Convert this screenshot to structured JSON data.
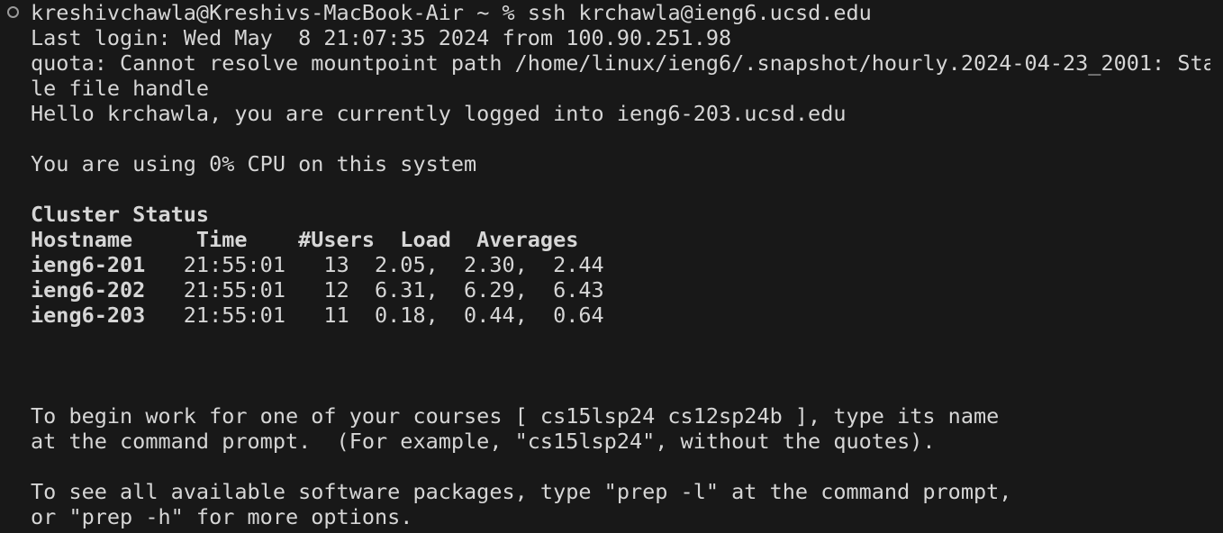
{
  "prompt": {
    "user_host": "kreshivchawla@Kreshivs-MacBook-Air",
    "path": "~",
    "symbol": "%",
    "command": "ssh krchawla@ieng6.ucsd.edu"
  },
  "login": {
    "last_login": "Last login: Wed May  8 21:07:35 2024 from 100.90.251.98",
    "quota_line1": "quota: Cannot resolve mountpoint path /home/linux/ieng6/.snapshot/hourly.2024-04-23_2001: Sta",
    "quota_line2": "le file handle",
    "hello": "Hello krchawla, you are currently logged into ieng6-203.ucsd.edu"
  },
  "cpu_line": "You are using 0% CPU on this system",
  "cluster": {
    "title": "Cluster Status",
    "header": "Hostname     Time    #Users  Load  Averages",
    "rows": [
      {
        "hostname": "ieng6-201",
        "rest": "   21:55:01   13  2.05,  2.30,  2.44"
      },
      {
        "hostname": "ieng6-202",
        "rest": "   21:55:01   12  6.31,  6.29,  6.43"
      },
      {
        "hostname": "ieng6-203",
        "rest": "   21:55:01   11  0.18,  0.44,  0.64"
      }
    ]
  },
  "courses": {
    "line1": "To begin work for one of your courses [ cs15lsp24 cs12sp24b ], type its name",
    "line2": "at the command prompt.  (For example, \"cs15lsp24\", without the quotes)."
  },
  "packages": {
    "line1": "To see all available software packages, type \"prep -l\" at the command prompt,",
    "line2": "or \"prep -h\" for more options."
  },
  "colors": {
    "background": "#181818",
    "text": "#d6d6d6",
    "gutter_circle": "#9a9a9a"
  }
}
